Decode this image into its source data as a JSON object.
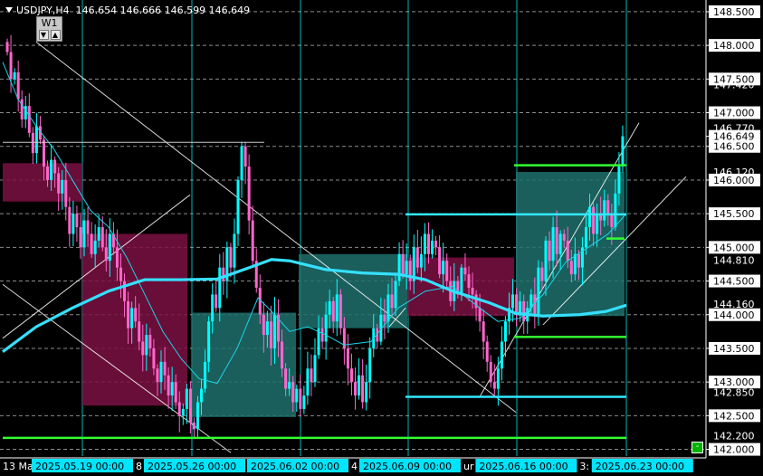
{
  "header": {
    "symbol": "USDJPY,H4",
    "ohlc": "146.654 146.666 146.599 146.649",
    "timeframe_badge": "W1",
    "badge_down": "▼",
    "badge_up": "▲",
    "corner_button": "-"
  },
  "colors": {
    "background": "#000000",
    "bull": "#00ffff",
    "bear": "#ff66cc",
    "ma_thick": "#35e0ff",
    "ma_thin": "#1bd3e8",
    "zone_bear": "#7a1042",
    "zone_bull": "#1f706c",
    "green_level": "#33ff33",
    "cyan_level": "#33e8ff",
    "date_label_bg": "#00e5ff",
    "price_tag_bg": "#ffffff",
    "grid": "#ffffff",
    "vline": "#00ffff"
  },
  "chart_data": {
    "type": "candlestick",
    "symbol": "USDJPY",
    "timeframe": "H4",
    "ylim": [
      141.9,
      148.62
    ],
    "price_axis_labels": [
      "148.500",
      "148.000",
      "147.500",
      "147.000",
      "146.500",
      "146.000",
      "145.500",
      "145.000",
      "144.500",
      "144.000",
      "143.500",
      "143.000",
      "142.500",
      "142.000"
    ],
    "price_levels": [
      "147.420",
      "146.770",
      "146.120",
      "144.810",
      "144.160",
      "142.850",
      "142.200"
    ],
    "current_price": "146.649",
    "time_labels": [
      {
        "text": "13 Ma",
        "highlight": false
      },
      {
        "text": "2025.05.19 00:00",
        "highlight": true
      },
      {
        "text": "8",
        "highlight": false
      },
      {
        "text": "2025.05.26 00:00",
        "highlight": true
      },
      {
        "text": "2025.06.02 00:00",
        "highlight": true
      },
      {
        "text": "4",
        "highlight": false
      },
      {
        "text": "2025.06.09 00:00",
        "highlight": true
      },
      {
        "text": "ur",
        "highlight": false
      },
      {
        "text": "2025.06.16 00:00",
        "highlight": true
      },
      {
        "text": "3:",
        "highlight": false
      },
      {
        "text": "2025.06.23 00:00",
        "highlight": true
      }
    ],
    "ohlc_path": [
      148.05,
      147.9,
      147.5,
      147.6,
      147.2,
      146.9,
      147.1,
      146.7,
      146.4,
      146.8,
      146.6,
      146.2,
      146.0,
      146.3,
      146.1,
      145.8,
      146.0,
      145.6,
      145.2,
      145.5,
      145.3,
      145.0,
      145.4,
      145.2,
      144.9,
      145.1,
      145.3,
      145.0,
      144.8,
      145.2,
      145.0,
      144.7,
      144.5,
      144.2,
      143.8,
      144.1,
      143.9,
      143.6,
      143.4,
      143.7,
      143.5,
      143.2,
      143.0,
      143.3,
      143.1,
      142.8,
      143.0,
      142.7,
      142.5,
      142.6,
      142.9,
      142.4,
      142.3,
      142.7,
      142.9,
      143.3,
      143.9,
      144.3,
      144.1,
      144.7,
      144.5,
      145.0,
      144.7,
      145.2,
      146.0,
      146.5,
      146.2,
      145.4,
      144.8,
      144.4,
      144.0,
      143.7,
      143.9,
      143.5,
      144.0,
      143.6,
      143.2,
      142.9,
      143.0,
      142.7,
      142.9,
      142.6,
      142.8,
      143.2,
      143.0,
      143.4,
      143.8,
      143.6,
      144.0,
      144.2,
      143.9,
      144.3,
      143.8,
      143.5,
      143.2,
      143.0,
      142.8,
      143.1,
      142.7,
      143.0,
      143.5,
      143.8,
      143.6,
      144.0,
      143.9,
      144.3,
      144.1,
      144.5,
      144.9,
      144.6,
      144.8,
      144.5,
      145.0,
      144.7,
      144.9,
      145.2,
      144.9,
      145.1,
      145.0,
      144.6,
      144.8,
      144.5,
      144.2,
      144.5,
      144.3,
      144.7,
      144.6,
      144.4,
      144.3,
      144.1,
      143.9,
      143.6,
      143.3,
      143.0,
      142.9,
      143.2,
      143.6,
      143.9,
      144.1,
      144.3,
      144.0,
      144.2,
      143.9,
      144.1,
      144.3,
      144.0,
      144.7,
      144.5,
      145.1,
      144.8,
      145.3,
      144.9,
      145.2,
      145.1,
      144.8,
      144.6,
      144.9,
      144.7,
      145.0,
      145.3,
      145.6,
      145.2,
      145.5,
      145.4,
      145.7,
      145.5,
      145.3,
      145.8,
      146.2,
      146.65
    ],
    "ma_slow": [
      [
        3,
        143.45
      ],
      [
        40,
        143.82
      ],
      [
        80,
        144.1
      ],
      [
        120,
        144.35
      ],
      [
        160,
        144.52
      ],
      [
        200,
        144.52
      ],
      [
        240,
        144.53
      ],
      [
        280,
        144.72
      ],
      [
        300,
        144.82
      ],
      [
        320,
        144.8
      ],
      [
        360,
        144.67
      ],
      [
        400,
        144.62
      ],
      [
        440,
        144.6
      ],
      [
        470,
        144.52
      ],
      [
        500,
        144.35
      ],
      [
        540,
        144.18
      ],
      [
        570,
        144.02
      ],
      [
        600,
        143.98
      ],
      [
        640,
        144.0
      ],
      [
        670,
        144.05
      ],
      [
        692,
        144.14
      ]
    ],
    "ma_fast": [
      [
        3,
        147.75
      ],
      [
        20,
        147.2
      ],
      [
        40,
        146.8
      ],
      [
        60,
        146.45
      ],
      [
        80,
        146.0
      ],
      [
        100,
        145.55
      ],
      [
        120,
        145.3
      ],
      [
        140,
        144.85
      ],
      [
        160,
        144.3
      ],
      [
        180,
        143.75
      ],
      [
        200,
        143.35
      ],
      [
        220,
        143.05
      ],
      [
        240,
        142.98
      ],
      [
        262,
        143.5
      ],
      [
        285,
        144.25
      ],
      [
        300,
        144.05
      ],
      [
        320,
        143.75
      ],
      [
        340,
        143.82
      ],
      [
        360,
        143.7
      ],
      [
        380,
        143.55
      ],
      [
        410,
        143.6
      ],
      [
        440,
        144.1
      ],
      [
        470,
        144.35
      ],
      [
        500,
        144.42
      ],
      [
        530,
        144.1
      ],
      [
        550,
        143.9
      ],
      [
        575,
        143.95
      ],
      [
        600,
        144.3
      ],
      [
        625,
        144.78
      ],
      [
        650,
        145.0
      ],
      [
        672,
        145.2
      ],
      [
        692,
        145.5
      ]
    ],
    "zones": [
      {
        "type": "bear",
        "x0": 3,
        "x1": 91,
        "y0": 146.25,
        "y1": 145.68
      },
      {
        "type": "bear",
        "x0": 91,
        "x1": 207,
        "y0": 145.2,
        "y1": 142.65
      },
      {
        "type": "bull",
        "x0": 212,
        "x1": 327,
        "y0": 144.03,
        "y1": 142.48
      },
      {
        "type": "bull",
        "x0": 330,
        "x1": 450,
        "y0": 144.9,
        "y1": 143.8
      },
      {
        "type": "bear",
        "x0": 450,
        "x1": 568,
        "y0": 144.85,
        "y1": 143.98
      },
      {
        "type": "bull",
        "x0": 570,
        "x1": 690,
        "y0": 146.12,
        "y1": 143.98
      }
    ],
    "levels": [
      {
        "color": "green",
        "x0": 3,
        "x1": 692,
        "price": 142.17
      },
      {
        "color": "green",
        "x0": 568,
        "x1": 692,
        "price": 146.22
      },
      {
        "color": "green",
        "x0": 568,
        "x1": 692,
        "price": 143.67
      },
      {
        "color": "green",
        "x0": 670,
        "x1": 690,
        "price": 145.13
      },
      {
        "color": "cyan",
        "x0": 448,
        "x1": 692,
        "price": 145.49
      },
      {
        "color": "cyan",
        "x0": 448,
        "x1": 692,
        "price": 142.78
      },
      {
        "color": "white",
        "x0": 3,
        "x1": 292,
        "price": 146.56
      }
    ],
    "trendlines": [
      {
        "from": [
          40,
          148.05
        ],
        "to": [
          570,
          142.55
        ]
      },
      {
        "from": [
          3,
          144.45
        ],
        "to": [
          255,
          141.95
        ]
      },
      {
        "from": [
          3,
          143.65
        ],
        "to": [
          210,
          145.78
        ]
      },
      {
        "from": [
          530,
          142.78
        ],
        "to": [
          706,
          146.85
        ]
      },
      {
        "from": [
          600,
          143.85
        ],
        "to": [
          758,
          146.05
        ]
      },
      {
        "from": [
          430,
          143.82
        ],
        "to": [
          448,
          144.1
        ]
      }
    ],
    "grid_prices": [
      148.5,
      148.0,
      147.5,
      147.0,
      146.5,
      146.0,
      145.5,
      145.0,
      144.5,
      144.0,
      143.5,
      143.0,
      142.5,
      142.0
    ],
    "vertical_markers": [
      91,
      212,
      332,
      451,
      571,
      692
    ]
  }
}
